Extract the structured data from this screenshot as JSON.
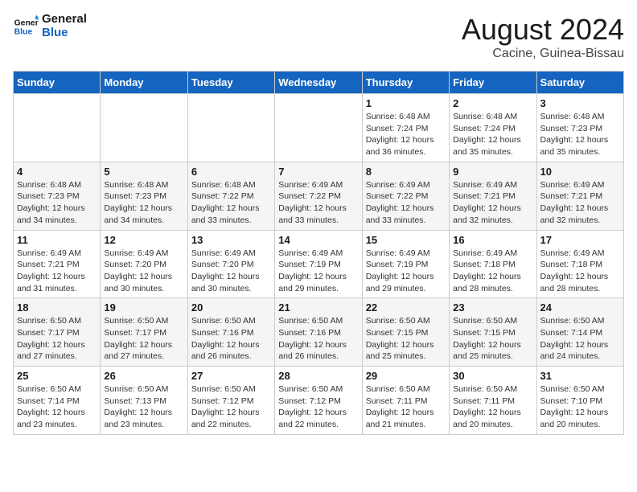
{
  "header": {
    "logo_general": "General",
    "logo_blue": "Blue",
    "month_title": "August 2024",
    "location": "Cacine, Guinea-Bissau"
  },
  "days_of_week": [
    "Sunday",
    "Monday",
    "Tuesday",
    "Wednesday",
    "Thursday",
    "Friday",
    "Saturday"
  ],
  "weeks": [
    [
      {
        "day": "",
        "info": ""
      },
      {
        "day": "",
        "info": ""
      },
      {
        "day": "",
        "info": ""
      },
      {
        "day": "",
        "info": ""
      },
      {
        "day": "1",
        "info": "Sunrise: 6:48 AM\nSunset: 7:24 PM\nDaylight: 12 hours\nand 36 minutes."
      },
      {
        "day": "2",
        "info": "Sunrise: 6:48 AM\nSunset: 7:24 PM\nDaylight: 12 hours\nand 35 minutes."
      },
      {
        "day": "3",
        "info": "Sunrise: 6:48 AM\nSunset: 7:23 PM\nDaylight: 12 hours\nand 35 minutes."
      }
    ],
    [
      {
        "day": "4",
        "info": "Sunrise: 6:48 AM\nSunset: 7:23 PM\nDaylight: 12 hours\nand 34 minutes."
      },
      {
        "day": "5",
        "info": "Sunrise: 6:48 AM\nSunset: 7:23 PM\nDaylight: 12 hours\nand 34 minutes."
      },
      {
        "day": "6",
        "info": "Sunrise: 6:48 AM\nSunset: 7:22 PM\nDaylight: 12 hours\nand 33 minutes."
      },
      {
        "day": "7",
        "info": "Sunrise: 6:49 AM\nSunset: 7:22 PM\nDaylight: 12 hours\nand 33 minutes."
      },
      {
        "day": "8",
        "info": "Sunrise: 6:49 AM\nSunset: 7:22 PM\nDaylight: 12 hours\nand 33 minutes."
      },
      {
        "day": "9",
        "info": "Sunrise: 6:49 AM\nSunset: 7:21 PM\nDaylight: 12 hours\nand 32 minutes."
      },
      {
        "day": "10",
        "info": "Sunrise: 6:49 AM\nSunset: 7:21 PM\nDaylight: 12 hours\nand 32 minutes."
      }
    ],
    [
      {
        "day": "11",
        "info": "Sunrise: 6:49 AM\nSunset: 7:21 PM\nDaylight: 12 hours\nand 31 minutes."
      },
      {
        "day": "12",
        "info": "Sunrise: 6:49 AM\nSunset: 7:20 PM\nDaylight: 12 hours\nand 30 minutes."
      },
      {
        "day": "13",
        "info": "Sunrise: 6:49 AM\nSunset: 7:20 PM\nDaylight: 12 hours\nand 30 minutes."
      },
      {
        "day": "14",
        "info": "Sunrise: 6:49 AM\nSunset: 7:19 PM\nDaylight: 12 hours\nand 29 minutes."
      },
      {
        "day": "15",
        "info": "Sunrise: 6:49 AM\nSunset: 7:19 PM\nDaylight: 12 hours\nand 29 minutes."
      },
      {
        "day": "16",
        "info": "Sunrise: 6:49 AM\nSunset: 7:18 PM\nDaylight: 12 hours\nand 28 minutes."
      },
      {
        "day": "17",
        "info": "Sunrise: 6:49 AM\nSunset: 7:18 PM\nDaylight: 12 hours\nand 28 minutes."
      }
    ],
    [
      {
        "day": "18",
        "info": "Sunrise: 6:50 AM\nSunset: 7:17 PM\nDaylight: 12 hours\nand 27 minutes."
      },
      {
        "day": "19",
        "info": "Sunrise: 6:50 AM\nSunset: 7:17 PM\nDaylight: 12 hours\nand 27 minutes."
      },
      {
        "day": "20",
        "info": "Sunrise: 6:50 AM\nSunset: 7:16 PM\nDaylight: 12 hours\nand 26 minutes."
      },
      {
        "day": "21",
        "info": "Sunrise: 6:50 AM\nSunset: 7:16 PM\nDaylight: 12 hours\nand 26 minutes."
      },
      {
        "day": "22",
        "info": "Sunrise: 6:50 AM\nSunset: 7:15 PM\nDaylight: 12 hours\nand 25 minutes."
      },
      {
        "day": "23",
        "info": "Sunrise: 6:50 AM\nSunset: 7:15 PM\nDaylight: 12 hours\nand 25 minutes."
      },
      {
        "day": "24",
        "info": "Sunrise: 6:50 AM\nSunset: 7:14 PM\nDaylight: 12 hours\nand 24 minutes."
      }
    ],
    [
      {
        "day": "25",
        "info": "Sunrise: 6:50 AM\nSunset: 7:14 PM\nDaylight: 12 hours\nand 23 minutes."
      },
      {
        "day": "26",
        "info": "Sunrise: 6:50 AM\nSunset: 7:13 PM\nDaylight: 12 hours\nand 23 minutes."
      },
      {
        "day": "27",
        "info": "Sunrise: 6:50 AM\nSunset: 7:12 PM\nDaylight: 12 hours\nand 22 minutes."
      },
      {
        "day": "28",
        "info": "Sunrise: 6:50 AM\nSunset: 7:12 PM\nDaylight: 12 hours\nand 22 minutes."
      },
      {
        "day": "29",
        "info": "Sunrise: 6:50 AM\nSunset: 7:11 PM\nDaylight: 12 hours\nand 21 minutes."
      },
      {
        "day": "30",
        "info": "Sunrise: 6:50 AM\nSunset: 7:11 PM\nDaylight: 12 hours\nand 20 minutes."
      },
      {
        "day": "31",
        "info": "Sunrise: 6:50 AM\nSunset: 7:10 PM\nDaylight: 12 hours\nand 20 minutes."
      }
    ]
  ]
}
